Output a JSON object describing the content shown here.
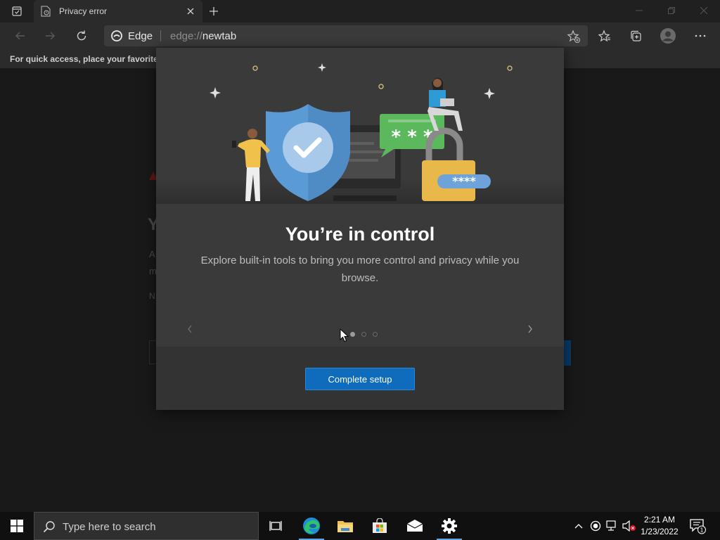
{
  "window": {
    "tab_title": "Privacy error"
  },
  "toolbar": {
    "site_label": "Edge",
    "url_scheme": "edge://",
    "url_path": "newtab"
  },
  "favorites_bar": {
    "hint": "For quick access, place your favorites here on the favorites bar."
  },
  "dialog": {
    "title": "You’re in control",
    "description": "Explore built-in tools to bring you more control and privacy while you browse.",
    "button_label": "Complete setup",
    "page_count": 3,
    "active_page": 1,
    "hero_password_dots": "****",
    "hero_chat_text": "* * *"
  },
  "background_page": {
    "fragments": [
      "Y",
      "A",
      "m",
      "N"
    ]
  },
  "taskbar": {
    "search_placeholder": "Type here to search",
    "clock_time": "2:21 AM",
    "clock_date": "1/23/2022",
    "notification_count": "1"
  },
  "colors": {
    "accent": "#0f6cbd",
    "dialog_bg": "#3a3a3a",
    "shield_blue": "#5b9bd5",
    "chat_green": "#5cb85c",
    "lock_gold": "#e8b84a"
  },
  "icons": {
    "tab_actions": "tab-actions-icon",
    "favicon": "document-warning-icon",
    "back": "back-arrow-icon",
    "forward": "forward-arrow-icon",
    "refresh": "refresh-icon",
    "favorites": "star-list-icon",
    "collections": "collections-icon",
    "profile": "person-icon",
    "more": "ellipsis-icon"
  }
}
